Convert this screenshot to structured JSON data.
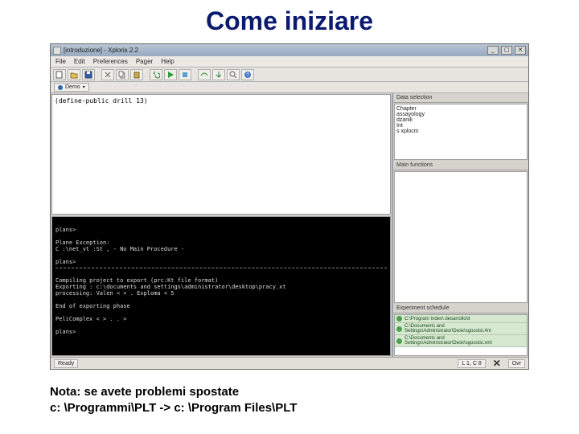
{
  "slide": {
    "title": "Come iniziare",
    "note_line1": "Nota: se avete problemi spostate",
    "note_line2": "c: \\Programmi\\PLT -> c: \\Program Files\\PLT"
  },
  "window": {
    "title": "[introduzione] - Xploris 2.2",
    "menus": [
      "File",
      "Edit",
      "Preferences",
      "Pager",
      "Help"
    ],
    "dialect_label": "Demo",
    "dialect_arrow": "▾"
  },
  "toolbar_icons": [
    "new-icon",
    "open-icon",
    "save-icon",
    "cut-icon",
    "copy-icon",
    "paste-icon",
    "undo-icon",
    "run-icon",
    "stop-icon",
    "step-over-icon",
    "step-into-icon",
    "zoom-icon",
    "help-icon"
  ],
  "editor": {
    "line1": "(define-public drill 13)"
  },
  "console": {
    "prompt1": "plans>",
    "error_header": "Plane Exception:",
    "error_body": "C :\\net_vt :St , - No Main Procedure -",
    "prompt2": "plans>",
    "divider": "----------------------",
    "msg1": "Compiling project to export (prc:Kt file format)",
    "msg2": "Exporting : c:\\documents and settings\\administrator\\desktop\\pracy.xt",
    "msg3": "processing: Valen < > . Exploma < 5",
    "done": "End of exporting phase",
    "result": "PeliComplex < > . . >",
    "prompt3": "plans>"
  },
  "right": {
    "datasel_label": "Data selection",
    "datasel_items": [
      "Chapter",
      "assayology",
      "dzanili",
      "Int",
      "s xplocm"
    ],
    "mainfun_label": "Main functions",
    "exp_label": "Experiment schedule",
    "exp_items": [
      "C:\\Program Index\\ desarrollo\\it",
      "C:\\Documents and Settings\\Administrator\\Desk\\sgoostsi.4m",
      "C:\\Documents and Settings\\Administrator\\Desk\\sgoostsi.xml"
    ]
  },
  "status": {
    "ready": "Ready",
    "pos": "L 1, C 8",
    "close": "✕",
    "mode": "Ovr"
  },
  "colors": {
    "title": "#0a1a6e"
  }
}
